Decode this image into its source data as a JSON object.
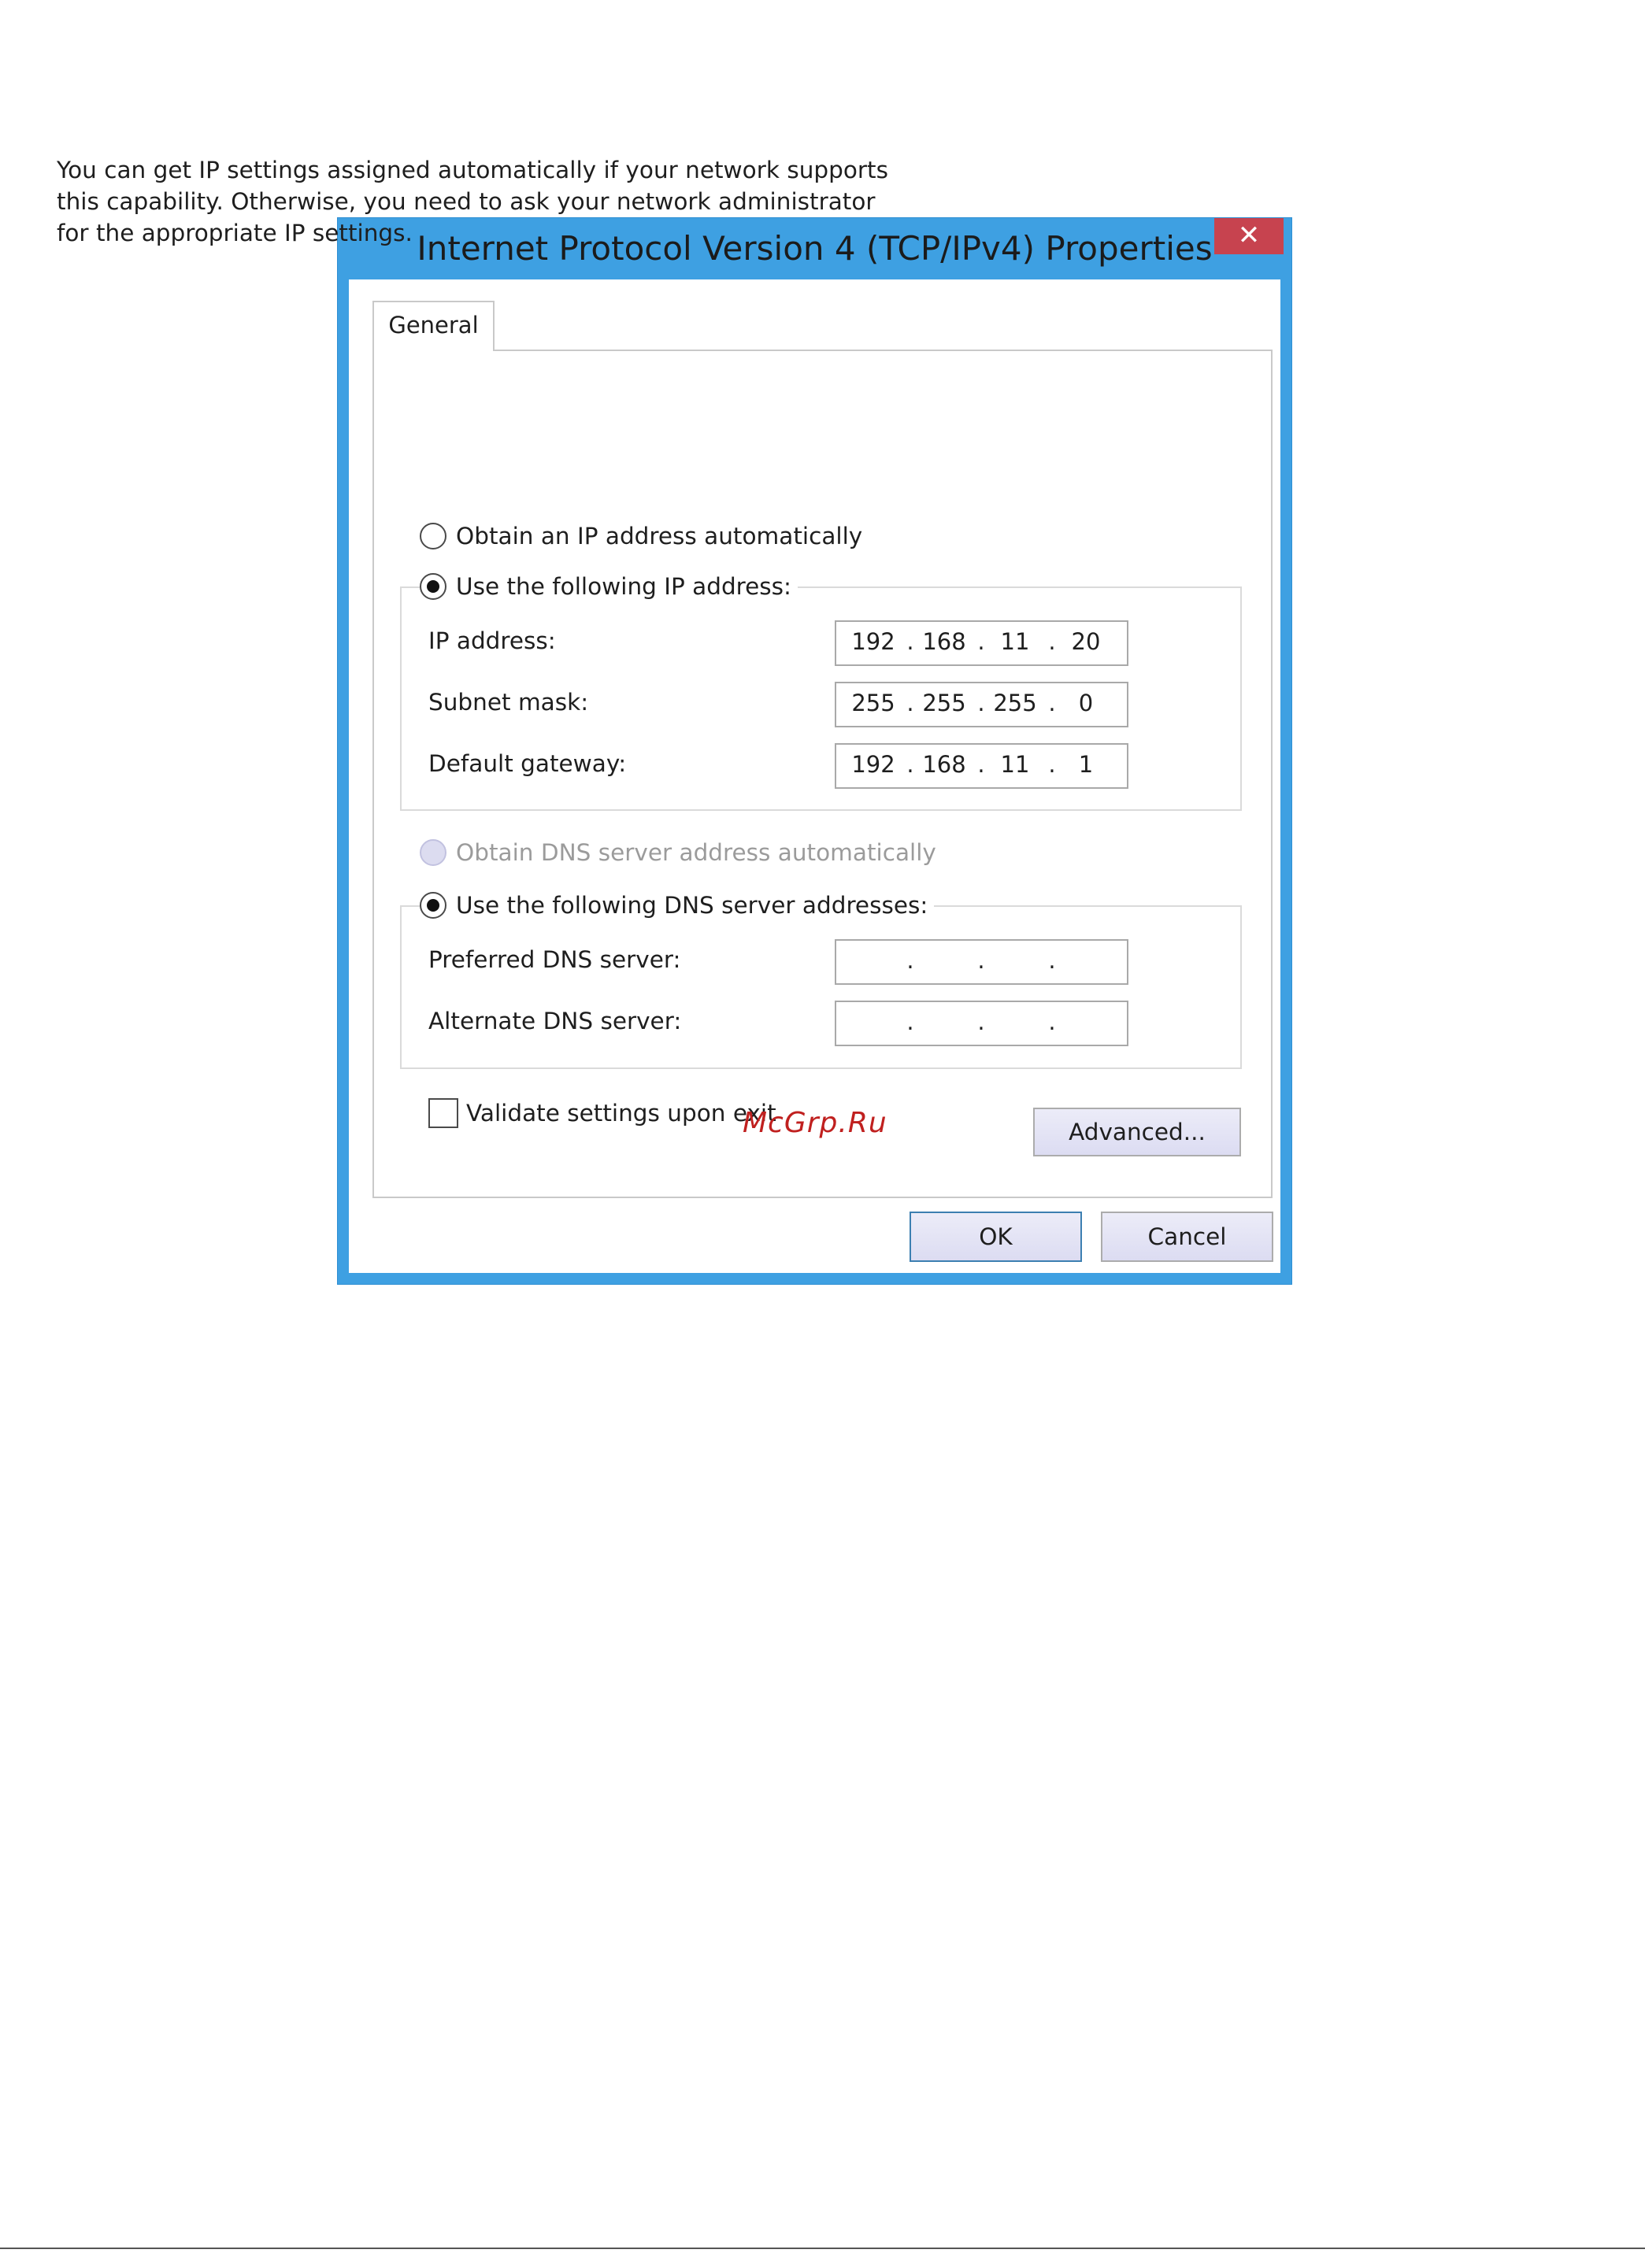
{
  "window": {
    "title": "Internet Protocol Version 4 (TCP/IPv4) Properties",
    "close_label": "✕"
  },
  "tabs": [
    {
      "label": "General"
    }
  ],
  "description": "You can get IP settings assigned automatically if your network supports this capability. Otherwise, you need to ask your network administrator for the appropriate IP settings.",
  "ip_mode": {
    "auto_label": "Obtain an IP address automatically",
    "auto_selected": false,
    "manual_label": "Use the following IP address:",
    "manual_selected": true
  },
  "ip_fields": {
    "ip_address": {
      "label": "IP address:",
      "octets": [
        "192",
        "168",
        "11",
        "20"
      ]
    },
    "subnet_mask": {
      "label": "Subnet mask:",
      "octets": [
        "255",
        "255",
        "255",
        "0"
      ]
    },
    "default_gateway": {
      "label": "Default gateway:",
      "octets": [
        "192",
        "168",
        "11",
        "1"
      ]
    }
  },
  "dns_mode": {
    "auto_label": "Obtain DNS server address automatically",
    "auto_selected": false,
    "auto_disabled": true,
    "manual_label": "Use the following DNS server addresses:",
    "manual_selected": true
  },
  "dns_fields": {
    "preferred": {
      "label": "Preferred DNS server:",
      "octets": [
        "",
        "",
        "",
        ""
      ]
    },
    "alternate": {
      "label": "Alternate DNS server:",
      "octets": [
        "",
        "",
        "",
        ""
      ]
    }
  },
  "validate": {
    "label": "Validate settings upon exit",
    "checked": false
  },
  "buttons": {
    "advanced": "Advanced...",
    "ok": "OK",
    "cancel": "Cancel"
  },
  "watermark": "McGrp.Ru",
  "colors": {
    "title_bar": "#3ea0e2",
    "close_button": "#c7434f",
    "button_face": "#dcdcf2",
    "watermark": "#c0201f"
  }
}
